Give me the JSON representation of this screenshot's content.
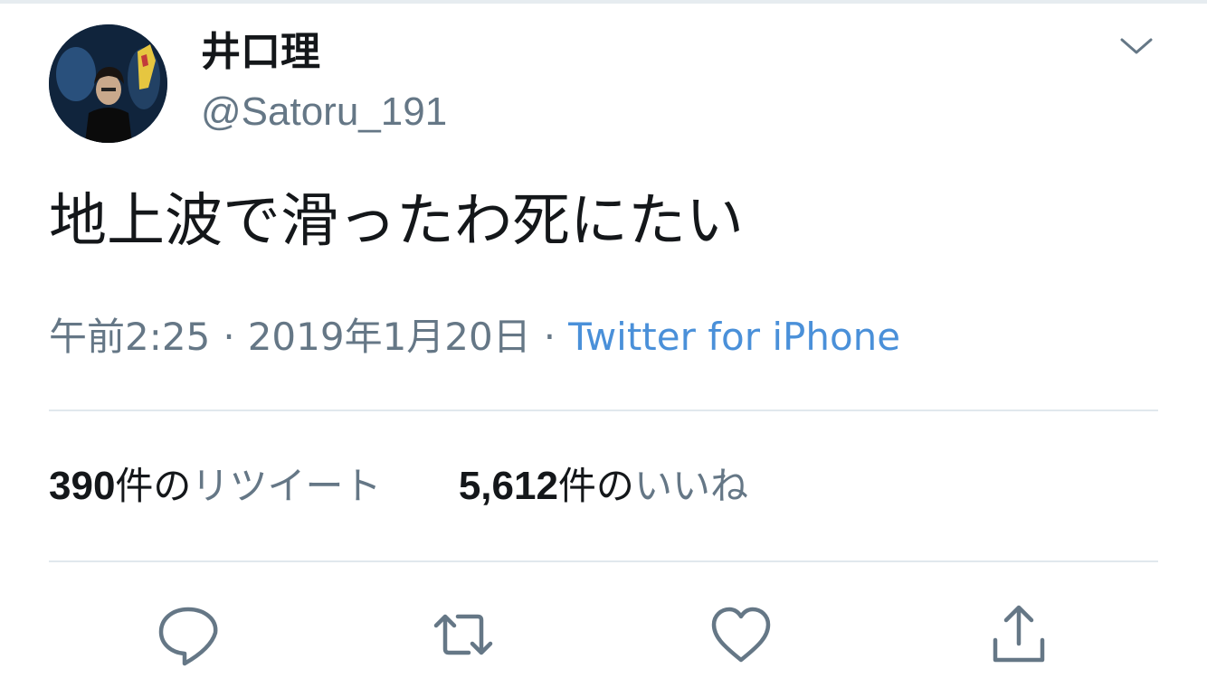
{
  "user": {
    "display_name": "井口理",
    "handle": "@Satoru_191"
  },
  "tweet": {
    "text": "地上波で滑ったわ死にたい",
    "time": "午前2:25",
    "date": "2019年1月20日",
    "separator": "·",
    "source": "Twitter for iPhone"
  },
  "stats": {
    "retweets": {
      "count": "390",
      "unit": "件の",
      "label": "リツイート"
    },
    "likes": {
      "count": "5,612",
      "unit": "件の",
      "label": "いいね"
    }
  },
  "actions": {
    "icons": [
      "reply-icon",
      "retweet-icon",
      "like-icon",
      "share-icon"
    ]
  },
  "colors": {
    "text": "#14171a",
    "secondary": "#657786",
    "link": "#1da1f2",
    "divider": "#e1e8ed",
    "icon": "#657786"
  }
}
